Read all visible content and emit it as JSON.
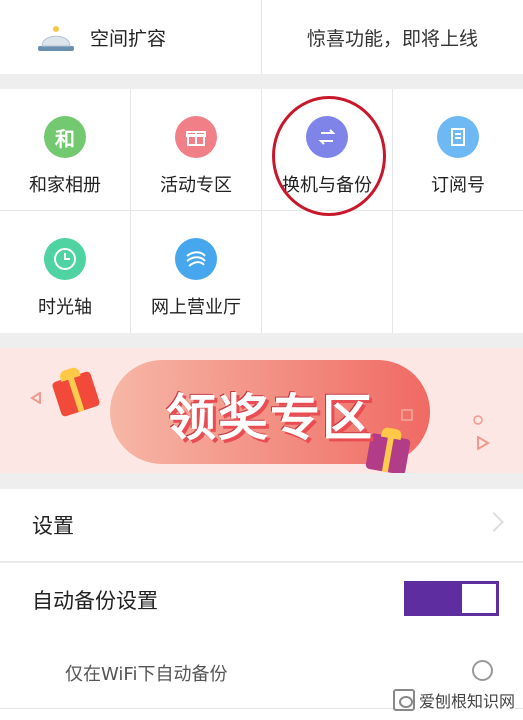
{
  "top": {
    "storage_label": "空间扩容",
    "coming_soon": "惊喜功能，即将上线"
  },
  "grid": {
    "items": [
      {
        "label": "和家相册",
        "icon": "和",
        "color": "#73c96f"
      },
      {
        "label": "活动专区",
        "icon": "gift-icon",
        "color": "#f07f87"
      },
      {
        "label": "换机与备份",
        "icon": "swap-icon",
        "color": "#7f84e8"
      },
      {
        "label": "订阅号",
        "icon": "document-icon",
        "color": "#6eb9f4"
      },
      {
        "label": "时光轴",
        "icon": "clock-icon",
        "color": "#4fd3a1"
      },
      {
        "label": "网上营业厅",
        "icon": "china-mobile-icon",
        "color": "#46a7ee"
      }
    ]
  },
  "banner": {
    "title": "领奖专区",
    "accent_colors": [
      "#fde7e4",
      "#f06a63",
      "#ffc947"
    ]
  },
  "settings": {
    "title": "设置",
    "auto_backup_label": "自动备份设置",
    "auto_backup_on": true,
    "wifi_only_label": "仅在WiFi下自动备份",
    "wifi_only_checked": false
  },
  "watermark": {
    "text": "爱刨根知识网"
  },
  "colors": {
    "highlight_ring": "#c8172a",
    "toggle": "#5e2da0",
    "background": "#eeeeee"
  }
}
